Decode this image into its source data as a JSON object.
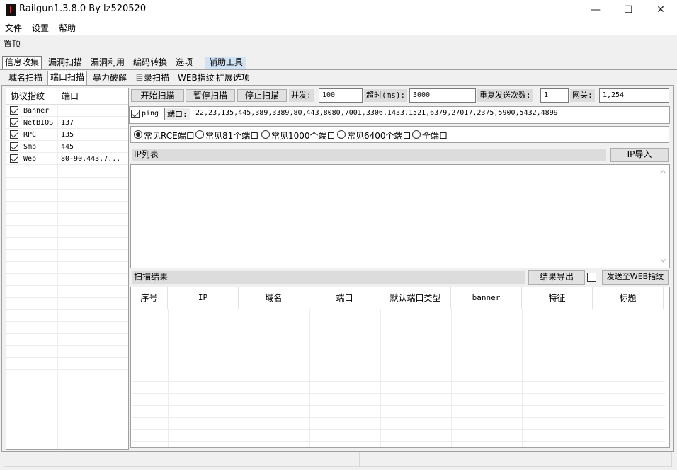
{
  "window": {
    "title": "Railgun1.3.8.0 By lz520520",
    "minimize": "—",
    "maximize": "☐",
    "close": "✕"
  },
  "menu": [
    "文件",
    "设置",
    "帮助"
  ],
  "pin_label": "置顶",
  "main_tabs": [
    "信息收集",
    "漏洞扫描",
    "漏洞利用",
    "编码转换",
    "选项",
    "辅助工具"
  ],
  "sub_tabs": [
    "域名扫描",
    "端口扫描",
    "暴力破解",
    "目录扫描",
    "WEB指纹",
    "扩展选项"
  ],
  "protocol_grid": {
    "headers": [
      "协议指纹",
      "端口"
    ],
    "rows": [
      {
        "name": "Banner",
        "ports": "",
        "checked": true
      },
      {
        "name": "NetBIOS",
        "ports": "137",
        "checked": true
      },
      {
        "name": "RPC",
        "ports": "135",
        "checked": true
      },
      {
        "name": "Smb",
        "ports": "445",
        "checked": true
      },
      {
        "name": "Web",
        "ports": "80-90,443,7...",
        "checked": true
      }
    ]
  },
  "toolbar": {
    "start": "开始扫描",
    "pause": "暂停扫描",
    "stop": "停止扫描",
    "concurrency_label": "并发:",
    "concurrency": "100",
    "timeout_label": "超时(ms):",
    "timeout": "3000",
    "retry_label": "重复发送次数:",
    "retry": "1",
    "gateway_label": "网关:",
    "gateway": "1,254"
  },
  "ping": {
    "label": "ping",
    "checked": true,
    "port_label": "端口:",
    "ports": "22,23,135,445,389,3389,80,443,8080,7001,3306,1433,1521,6379,27017,2375,5900,5432,4899"
  },
  "port_presets": [
    {
      "label": "常见RCE端口",
      "selected": true
    },
    {
      "label": "常见81个端口",
      "selected": false
    },
    {
      "label": "常见1000个端口",
      "selected": false
    },
    {
      "label": "常见6400个端口",
      "selected": false
    },
    {
      "label": "全端口",
      "selected": false
    }
  ],
  "ip_list": {
    "label": "IP列表",
    "import_button": "IP导入"
  },
  "results": {
    "label": "扫描结果",
    "export_button": "结果导出",
    "send_button": "发送至WEB指纹",
    "columns": [
      "序号",
      "IP",
      "域名",
      "端口",
      "默认端口类型",
      "banner",
      "特征",
      "标题"
    ]
  }
}
